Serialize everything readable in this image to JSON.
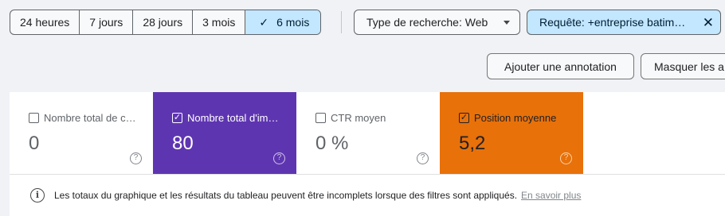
{
  "date_range": {
    "options": [
      "24 heures",
      "7 jours",
      "28 jours",
      "3 mois",
      "6 mois"
    ],
    "selected": "6 mois"
  },
  "filters": {
    "search_type": "Type de recherche: Web",
    "query": "Requête: +entreprise batim…"
  },
  "actions": {
    "add_annotation": "Ajouter une annotation",
    "hide": "Masquer les a"
  },
  "metrics": [
    {
      "label": "Nombre total de c…",
      "value": "0",
      "checked": false
    },
    {
      "label": "Nombre total d'im…",
      "value": "80",
      "checked": true
    },
    {
      "label": "CTR moyen",
      "value": "0 %",
      "checked": false
    },
    {
      "label": "Position moyenne",
      "value": "5,2",
      "checked": true
    }
  ],
  "info": {
    "message": "Les totaux du graphique et les résultats du tableau peuvent être incomplets lorsque des filtres sont appliqués.",
    "link": "En savoir plus"
  },
  "colors": {
    "impressions_card": "#5e35b1",
    "position_card": "#e8710a",
    "selected_chip": "#c2e7ff"
  },
  "icons": {
    "check": "check-icon",
    "dropdown": "caret-down-icon",
    "close": "close-icon",
    "help": "help-circle-icon",
    "info": "info-circle-icon"
  }
}
